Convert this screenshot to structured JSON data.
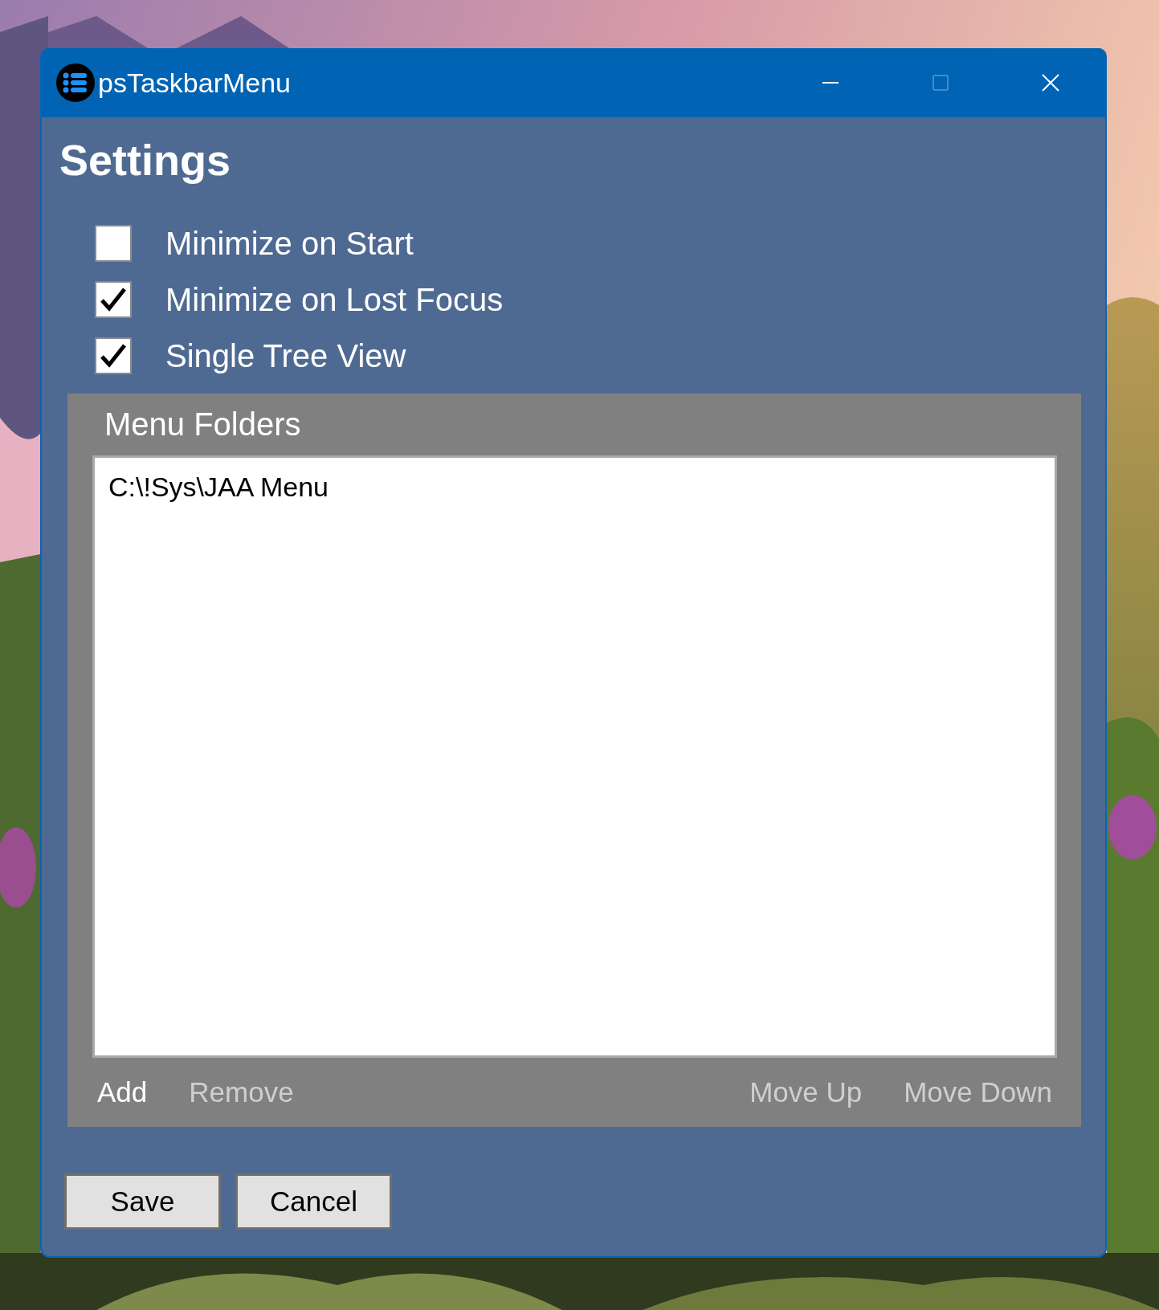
{
  "window": {
    "title": "psTaskbarMenu",
    "controls": [
      {
        "kind": "minimize",
        "disabled": false
      },
      {
        "kind": "maximize",
        "disabled": true
      },
      {
        "kind": "close",
        "disabled": false
      }
    ]
  },
  "heading": "Settings",
  "options": [
    {
      "label": "Minimize on Start",
      "checked": false
    },
    {
      "label": "Minimize on Lost Focus",
      "checked": true
    },
    {
      "label": "Single Tree View",
      "checked": true
    }
  ],
  "menu_folders": {
    "title": "Menu Folders",
    "items": [
      "C:\\!Sys\\JAA Menu"
    ],
    "left_actions": [
      {
        "label": "Add",
        "disabled": false
      },
      {
        "label": "Remove",
        "disabled": true
      }
    ],
    "right_actions": [
      {
        "label": "Move Up",
        "disabled": true
      },
      {
        "label": "Move Down",
        "disabled": true
      }
    ]
  },
  "buttons": [
    "Save",
    "Cancel"
  ]
}
